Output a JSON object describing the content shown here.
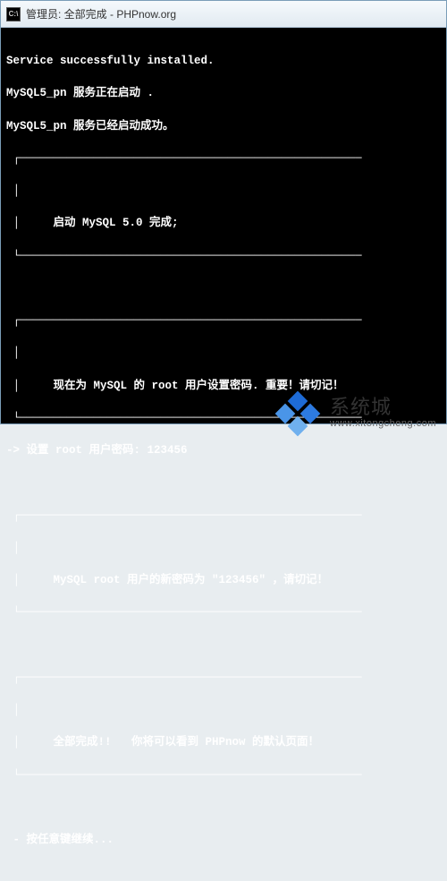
{
  "titlebar": {
    "text": "管理员: 全部完成 - PHPnow.org",
    "icon_glyph": "C:\\"
  },
  "console": {
    "l1": "Service successfully installed.",
    "l2": "MySQL5_pn 服务正在启动 .",
    "l3": "MySQL5_pn 服务已经启动成功。",
    "box1": "     启动 MySQL 5.0 完成;",
    "box2": "     现在为 MySQL 的 root 用户设置密码. 重要！请切记！",
    "prompt": "-> 设置 root 用户密码: 123456",
    "box3": "     MySQL root 用户的新密码为 \"123456\" ，请切记！",
    "box4": "     全部完成!!   你将可以看到 PHPnow 的默认页面！",
    "cont": " - 按任意键继续..."
  },
  "watermark": {
    "name": "系统城",
    "url": "www.xitongcheng.com"
  }
}
